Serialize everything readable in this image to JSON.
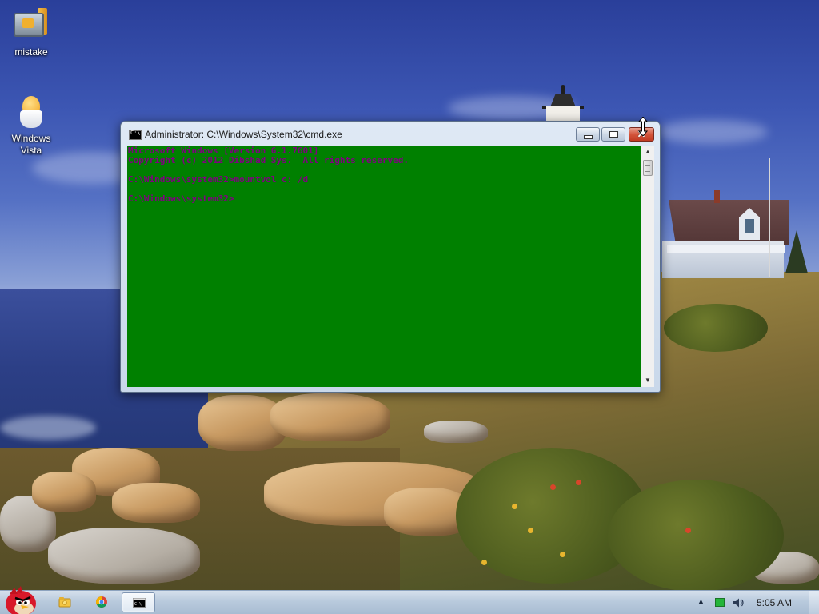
{
  "desktop": {
    "icons": [
      {
        "label": "mistake",
        "icon": "computer-folder-icon"
      },
      {
        "label": "Windows\nVista",
        "icon": "egg-cup-icon"
      }
    ]
  },
  "cmd_window": {
    "title": "Administrator: C:\\Windows\\System32\\cmd.exe",
    "title_icon": "console-icon",
    "controls": {
      "minimize_icon": "minimize-icon",
      "maximize_icon": "restore-icon",
      "close_label": "✕"
    },
    "console": {
      "background_color": "#008000",
      "text_color": "#800080",
      "lines": [
        "Microsoft Windows [Version 6.1.7601]",
        "Copyright (c) 2012 Dibshad Sys.  All rights reserved.",
        "",
        "C:\\Windows\\system32>mountvol c: /d",
        "",
        "C:\\Windows\\system32>"
      ]
    },
    "scrollbar": {
      "up_arrow": "▲",
      "down_arrow": "▼"
    }
  },
  "taskbar": {
    "start_icon": "angry-bird-start-icon",
    "pinned": [
      {
        "name": "explorer",
        "icon": "folder-icon"
      },
      {
        "name": "chrome",
        "icon": "chrome-icon"
      },
      {
        "name": "cmd",
        "icon": "console-icon",
        "active": true
      }
    ],
    "tray": {
      "expand_arrow": "▲",
      "battery_icon": "battery-icon",
      "volume_icon": "volume-icon",
      "clock": "5:05 AM"
    }
  }
}
